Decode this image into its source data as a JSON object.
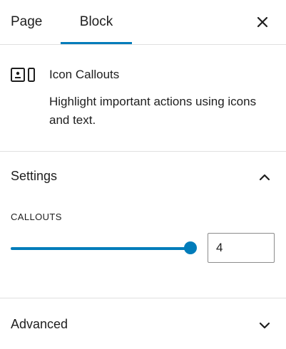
{
  "tabs": {
    "page_label": "Page",
    "block_label": "Block",
    "active": "Block",
    "accent_color": "#007cba"
  },
  "close_icon": "close-icon",
  "block_card": {
    "icon": "icon-callouts-block-icon",
    "title": "Icon Callouts",
    "description": "Highlight important actions using icons and text."
  },
  "settings": {
    "title": "Settings",
    "expanded": true,
    "chevron_icon": "chevron-up-icon",
    "callouts": {
      "label": "CALLOUTS",
      "value": "4",
      "slider_fraction": 1.0
    }
  },
  "advanced": {
    "title": "Advanced",
    "expanded": false,
    "chevron_icon": "chevron-down-icon"
  }
}
